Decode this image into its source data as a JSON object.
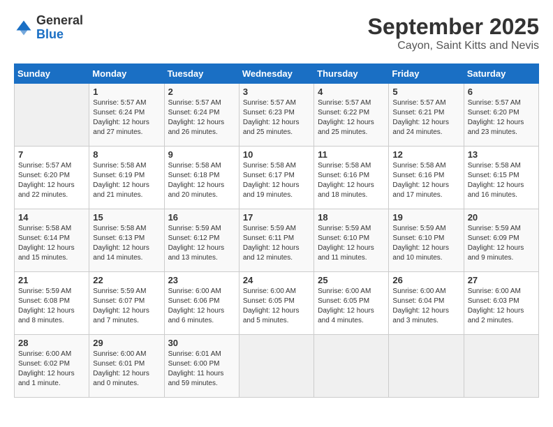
{
  "header": {
    "logo_general": "General",
    "logo_blue": "Blue",
    "month": "September 2025",
    "location": "Cayon, Saint Kitts and Nevis"
  },
  "weekdays": [
    "Sunday",
    "Monday",
    "Tuesday",
    "Wednesday",
    "Thursday",
    "Friday",
    "Saturday"
  ],
  "weeks": [
    [
      {
        "day": "",
        "sunrise": "",
        "sunset": "",
        "daylight": ""
      },
      {
        "day": "1",
        "sunrise": "Sunrise: 5:57 AM",
        "sunset": "Sunset: 6:24 PM",
        "daylight": "Daylight: 12 hours and 27 minutes."
      },
      {
        "day": "2",
        "sunrise": "Sunrise: 5:57 AM",
        "sunset": "Sunset: 6:24 PM",
        "daylight": "Daylight: 12 hours and 26 minutes."
      },
      {
        "day": "3",
        "sunrise": "Sunrise: 5:57 AM",
        "sunset": "Sunset: 6:23 PM",
        "daylight": "Daylight: 12 hours and 25 minutes."
      },
      {
        "day": "4",
        "sunrise": "Sunrise: 5:57 AM",
        "sunset": "Sunset: 6:22 PM",
        "daylight": "Daylight: 12 hours and 25 minutes."
      },
      {
        "day": "5",
        "sunrise": "Sunrise: 5:57 AM",
        "sunset": "Sunset: 6:21 PM",
        "daylight": "Daylight: 12 hours and 24 minutes."
      },
      {
        "day": "6",
        "sunrise": "Sunrise: 5:57 AM",
        "sunset": "Sunset: 6:20 PM",
        "daylight": "Daylight: 12 hours and 23 minutes."
      }
    ],
    [
      {
        "day": "7",
        "sunrise": "Sunrise: 5:57 AM",
        "sunset": "Sunset: 6:20 PM",
        "daylight": "Daylight: 12 hours and 22 minutes."
      },
      {
        "day": "8",
        "sunrise": "Sunrise: 5:58 AM",
        "sunset": "Sunset: 6:19 PM",
        "daylight": "Daylight: 12 hours and 21 minutes."
      },
      {
        "day": "9",
        "sunrise": "Sunrise: 5:58 AM",
        "sunset": "Sunset: 6:18 PM",
        "daylight": "Daylight: 12 hours and 20 minutes."
      },
      {
        "day": "10",
        "sunrise": "Sunrise: 5:58 AM",
        "sunset": "Sunset: 6:17 PM",
        "daylight": "Daylight: 12 hours and 19 minutes."
      },
      {
        "day": "11",
        "sunrise": "Sunrise: 5:58 AM",
        "sunset": "Sunset: 6:16 PM",
        "daylight": "Daylight: 12 hours and 18 minutes."
      },
      {
        "day": "12",
        "sunrise": "Sunrise: 5:58 AM",
        "sunset": "Sunset: 6:16 PM",
        "daylight": "Daylight: 12 hours and 17 minutes."
      },
      {
        "day": "13",
        "sunrise": "Sunrise: 5:58 AM",
        "sunset": "Sunset: 6:15 PM",
        "daylight": "Daylight: 12 hours and 16 minutes."
      }
    ],
    [
      {
        "day": "14",
        "sunrise": "Sunrise: 5:58 AM",
        "sunset": "Sunset: 6:14 PM",
        "daylight": "Daylight: 12 hours and 15 minutes."
      },
      {
        "day": "15",
        "sunrise": "Sunrise: 5:58 AM",
        "sunset": "Sunset: 6:13 PM",
        "daylight": "Daylight: 12 hours and 14 minutes."
      },
      {
        "day": "16",
        "sunrise": "Sunrise: 5:59 AM",
        "sunset": "Sunset: 6:12 PM",
        "daylight": "Daylight: 12 hours and 13 minutes."
      },
      {
        "day": "17",
        "sunrise": "Sunrise: 5:59 AM",
        "sunset": "Sunset: 6:11 PM",
        "daylight": "Daylight: 12 hours and 12 minutes."
      },
      {
        "day": "18",
        "sunrise": "Sunrise: 5:59 AM",
        "sunset": "Sunset: 6:10 PM",
        "daylight": "Daylight: 12 hours and 11 minutes."
      },
      {
        "day": "19",
        "sunrise": "Sunrise: 5:59 AM",
        "sunset": "Sunset: 6:10 PM",
        "daylight": "Daylight: 12 hours and 10 minutes."
      },
      {
        "day": "20",
        "sunrise": "Sunrise: 5:59 AM",
        "sunset": "Sunset: 6:09 PM",
        "daylight": "Daylight: 12 hours and 9 minutes."
      }
    ],
    [
      {
        "day": "21",
        "sunrise": "Sunrise: 5:59 AM",
        "sunset": "Sunset: 6:08 PM",
        "daylight": "Daylight: 12 hours and 8 minutes."
      },
      {
        "day": "22",
        "sunrise": "Sunrise: 5:59 AM",
        "sunset": "Sunset: 6:07 PM",
        "daylight": "Daylight: 12 hours and 7 minutes."
      },
      {
        "day": "23",
        "sunrise": "Sunrise: 6:00 AM",
        "sunset": "Sunset: 6:06 PM",
        "daylight": "Daylight: 12 hours and 6 minutes."
      },
      {
        "day": "24",
        "sunrise": "Sunrise: 6:00 AM",
        "sunset": "Sunset: 6:05 PM",
        "daylight": "Daylight: 12 hours and 5 minutes."
      },
      {
        "day": "25",
        "sunrise": "Sunrise: 6:00 AM",
        "sunset": "Sunset: 6:05 PM",
        "daylight": "Daylight: 12 hours and 4 minutes."
      },
      {
        "day": "26",
        "sunrise": "Sunrise: 6:00 AM",
        "sunset": "Sunset: 6:04 PM",
        "daylight": "Daylight: 12 hours and 3 minutes."
      },
      {
        "day": "27",
        "sunrise": "Sunrise: 6:00 AM",
        "sunset": "Sunset: 6:03 PM",
        "daylight": "Daylight: 12 hours and 2 minutes."
      }
    ],
    [
      {
        "day": "28",
        "sunrise": "Sunrise: 6:00 AM",
        "sunset": "Sunset: 6:02 PM",
        "daylight": "Daylight: 12 hours and 1 minute."
      },
      {
        "day": "29",
        "sunrise": "Sunrise: 6:00 AM",
        "sunset": "Sunset: 6:01 PM",
        "daylight": "Daylight: 12 hours and 0 minutes."
      },
      {
        "day": "30",
        "sunrise": "Sunrise: 6:01 AM",
        "sunset": "Sunset: 6:00 PM",
        "daylight": "Daylight: 11 hours and 59 minutes."
      },
      {
        "day": "",
        "sunrise": "",
        "sunset": "",
        "daylight": ""
      },
      {
        "day": "",
        "sunrise": "",
        "sunset": "",
        "daylight": ""
      },
      {
        "day": "",
        "sunrise": "",
        "sunset": "",
        "daylight": ""
      },
      {
        "day": "",
        "sunrise": "",
        "sunset": "",
        "daylight": ""
      }
    ]
  ]
}
